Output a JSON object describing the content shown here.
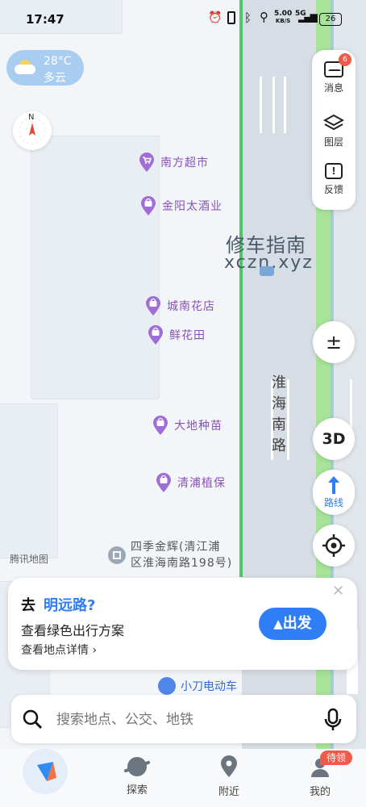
{
  "status_bar": {
    "time": "17:47",
    "speed_value": "5.00",
    "speed_unit": "KB/S",
    "battery": "26",
    "network": "5G"
  },
  "weather": {
    "temp": "28°C",
    "desc": "多云"
  },
  "compass": {
    "north": "N"
  },
  "right_panel": {
    "messages_label": "消息",
    "messages_badge": "6",
    "layers_label": "图层",
    "feedback_label": "反馈"
  },
  "map_controls": {
    "zoom_label": "±",
    "three_d_label": "3D",
    "route_label": "路线"
  },
  "pois": [
    {
      "name": "南方超市"
    },
    {
      "name": "金阳太酒业"
    },
    {
      "name": "城南花店"
    },
    {
      "name": "鲜花田"
    },
    {
      "name": "大地种苗"
    },
    {
      "name": "清浦植保"
    },
    {
      "name": "四季金辉(清江浦"
    },
    {
      "name": "区淮海南路198号)"
    },
    {
      "name": "小刀电动车"
    }
  ],
  "road_label": [
    "淮",
    "海",
    "南",
    "路"
  ],
  "watermark": {
    "line1": "修车指南",
    "line2": "xczn.xyz"
  },
  "map_attribution": "腾讯地图",
  "go_card": {
    "prefix": "去",
    "destination": "明远路?",
    "green_text": "查看绿色出行方案",
    "detail_text": "查看地点详情",
    "detail_arrow": "›",
    "go_button": "出发"
  },
  "search": {
    "placeholder": "搜索地点、公交、地铁"
  },
  "tabbar": {
    "explore": "探索",
    "nearby": "附近",
    "mine": "我的",
    "mine_badge": "待领取"
  },
  "colors": {
    "accent": "#2f7ef5",
    "poi_purple": "#a06cd5",
    "road_green": "#a8e39a",
    "badge_red": "#f05a4a"
  }
}
